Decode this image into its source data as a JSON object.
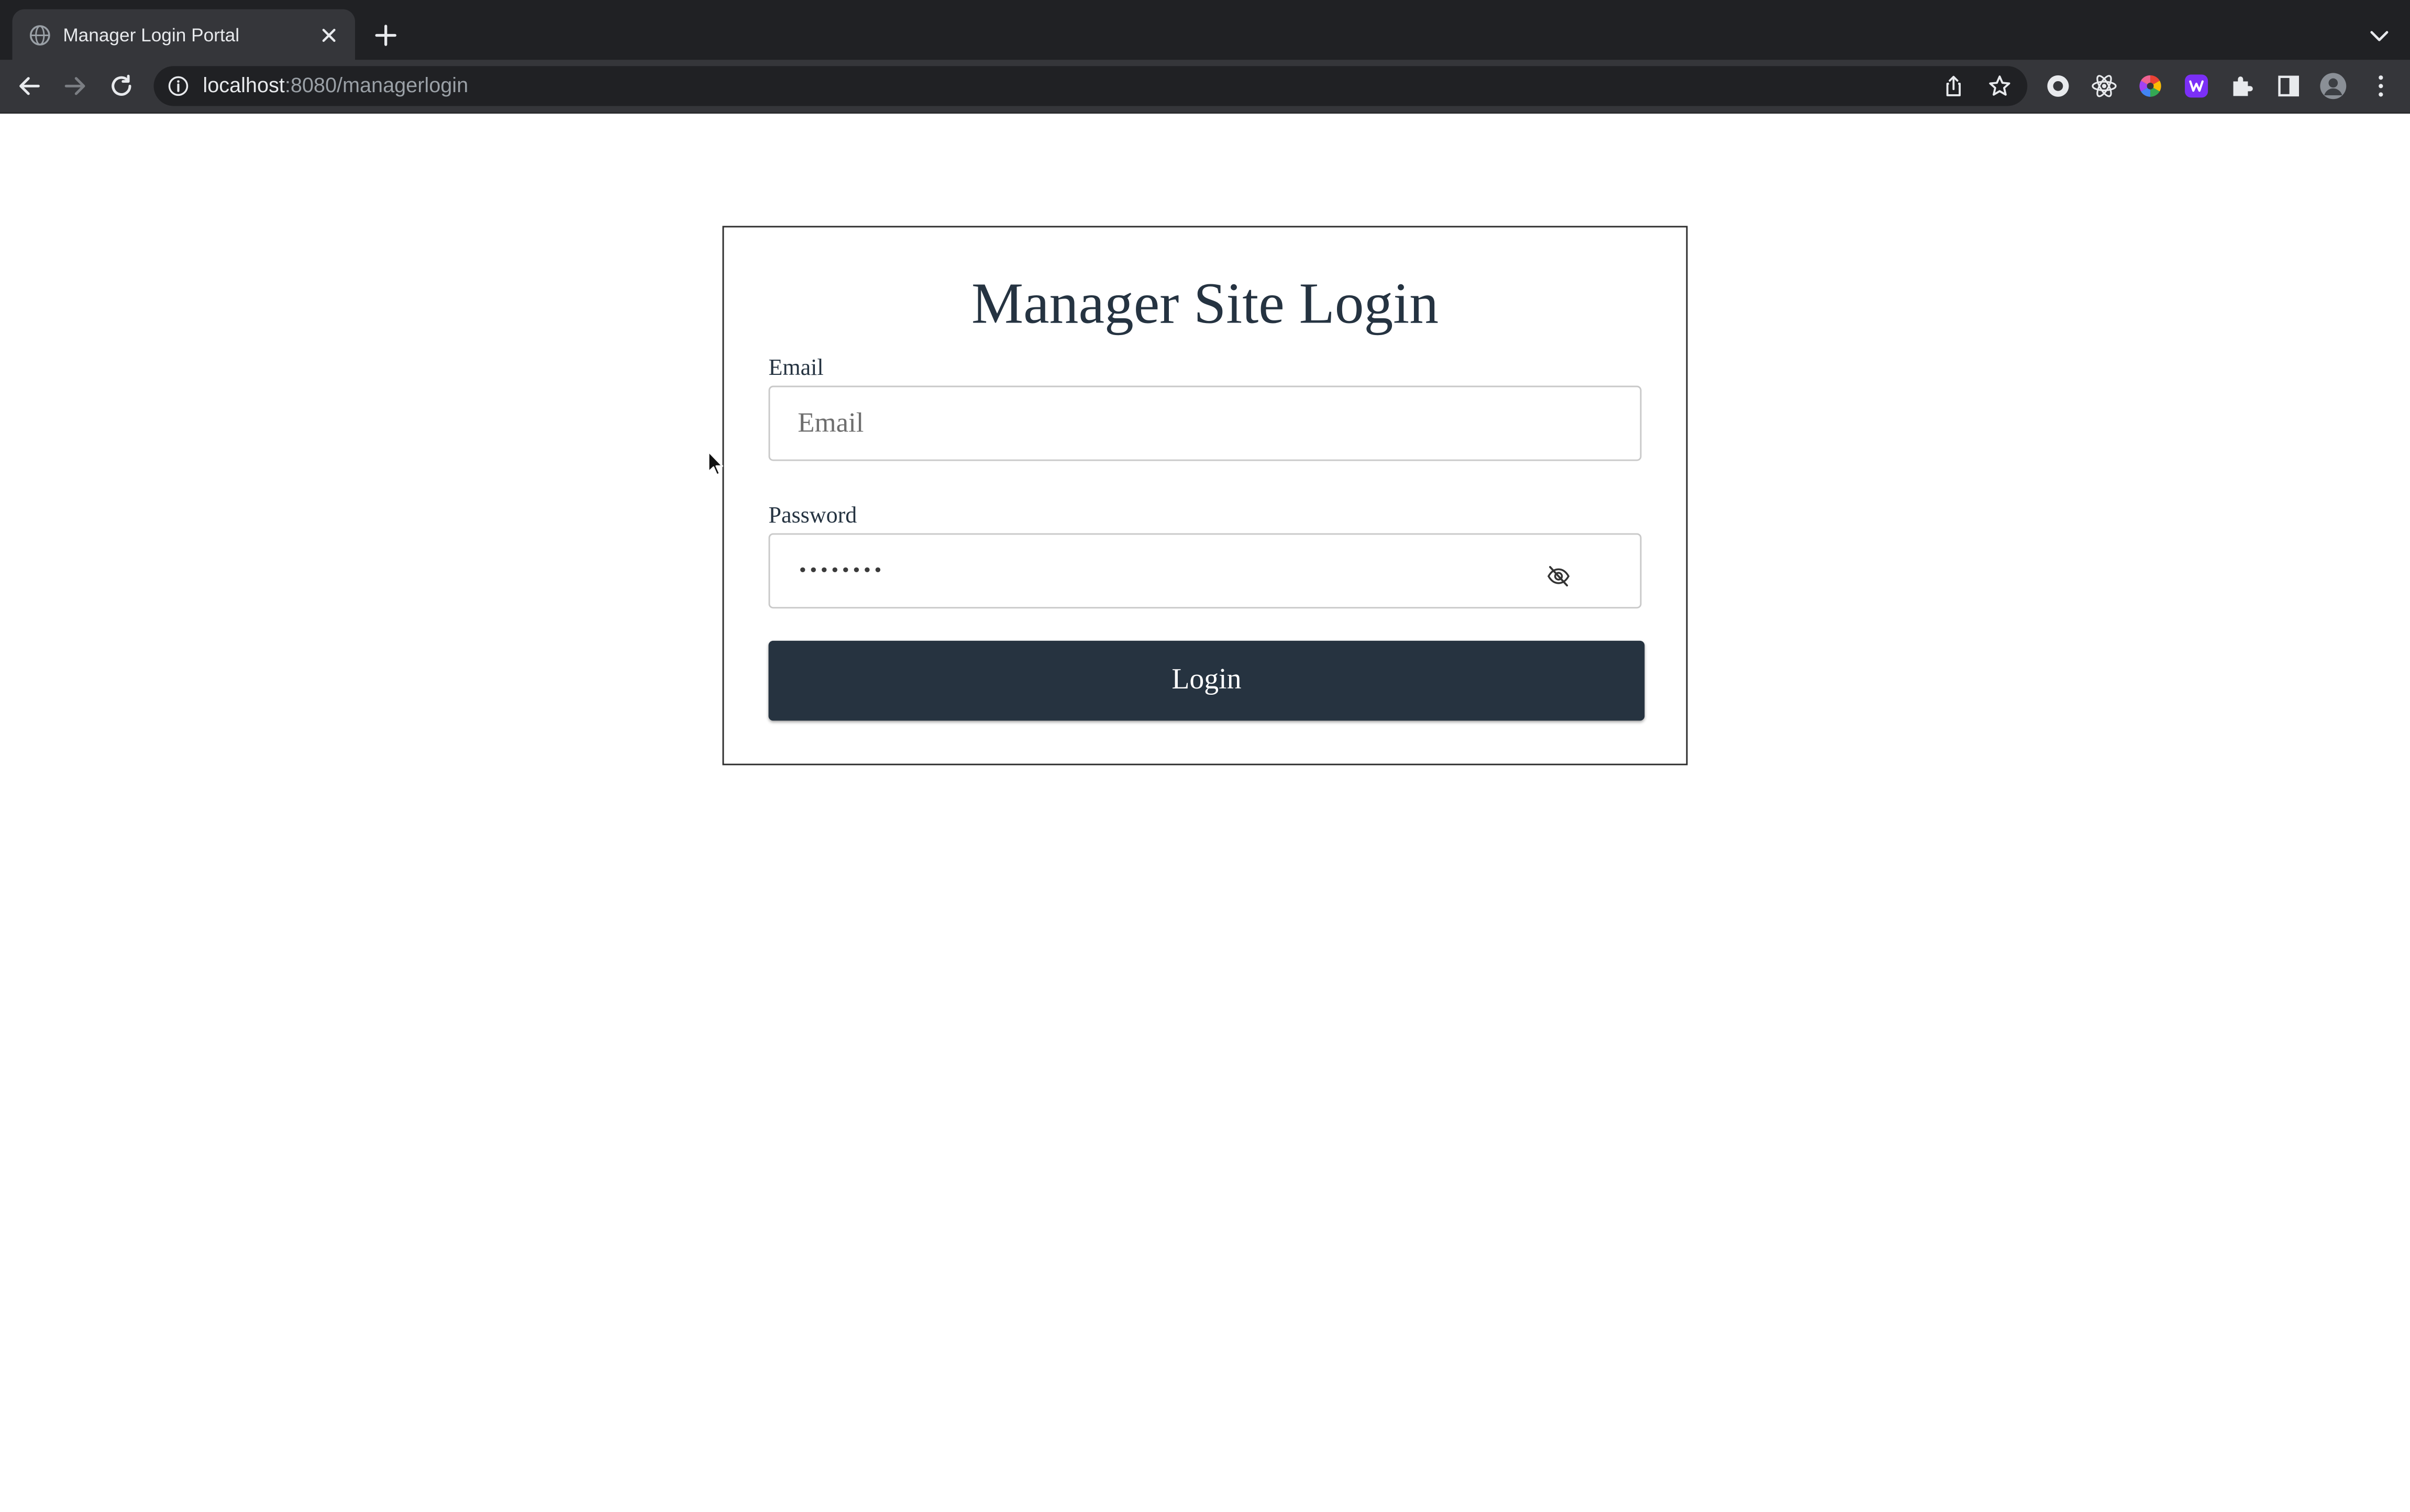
{
  "browser": {
    "tab": {
      "title": "Manager Login Portal",
      "favicon": "globe-icon",
      "close_icon": "close-icon"
    },
    "new_tab_icon": "plus-icon",
    "tab_search_icon": "chevron-down-icon",
    "toolbar": {
      "back_icon": "arrow-left-icon",
      "forward_icon": "arrow-right-icon",
      "reload_icon": "reload-icon",
      "site_info_icon": "info-icon",
      "url_host": "localhost",
      "url_rest": ":8080/managerlogin",
      "share_icon": "share-icon",
      "bookmark_icon": "star-icon"
    },
    "extensions": [
      "extension-circle-icon",
      "react-devtools-icon",
      "color-wheel-icon",
      "purple-extension-icon",
      "puzzle-icon",
      "side-panel-icon",
      "profile-avatar-icon",
      "menu-kebab-icon"
    ]
  },
  "login": {
    "title": "Manager Site Login",
    "email_label": "Email",
    "email_placeholder": "Email",
    "email_value": "",
    "password_label": "Password",
    "password_masked": "••••••••",
    "password_toggle_icon": "eye-slash-icon",
    "button_label": "Login"
  },
  "colors": {
    "chrome_dark": "#202124",
    "chrome_toolbar": "#35363a",
    "heading_text": "#253341",
    "button_bg": "#263340",
    "card_border": "#2e2e2e",
    "field_border": "#c9c9c9"
  }
}
